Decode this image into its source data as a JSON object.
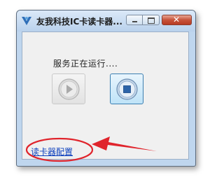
{
  "window": {
    "title": "友我科技IC卡读卡器...",
    "close_symbol": "✕"
  },
  "main": {
    "status_text": "服务正在运行....",
    "start_button": {
      "icon": "play-icon",
      "enabled": false
    },
    "stop_button": {
      "icon": "stop-icon",
      "enabled": true
    }
  },
  "footer": {
    "config_link_label": "读卡器配置"
  },
  "colors": {
    "annotation": "#e0242c",
    "link": "#0b3fbd",
    "titlebar": "#c7dcf2"
  }
}
